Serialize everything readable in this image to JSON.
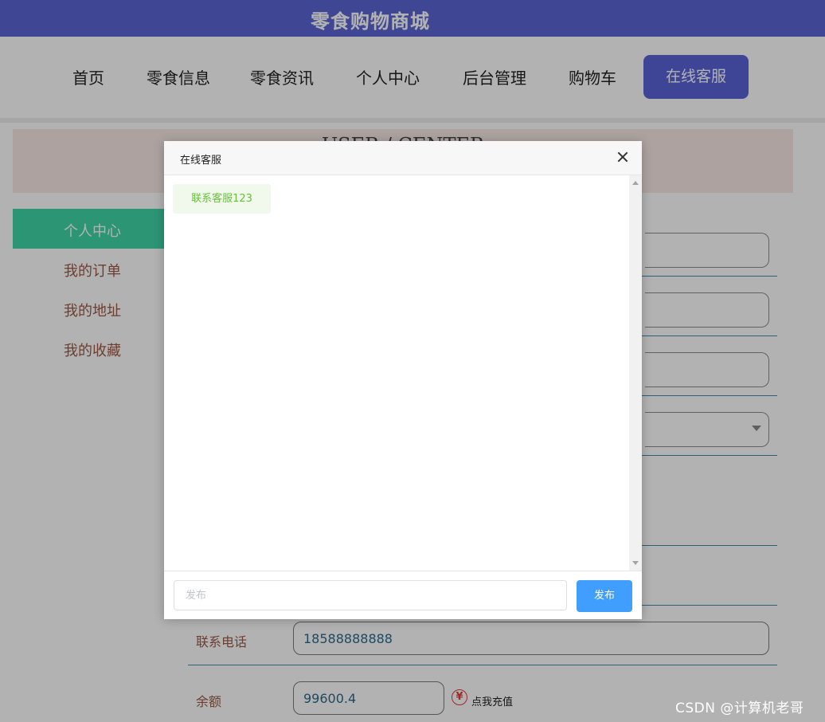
{
  "site": {
    "title": "零食购物商城"
  },
  "nav": {
    "items": [
      "首页",
      "零食信息",
      "零食资讯",
      "个人中心",
      "后台管理",
      "购物车"
    ],
    "customer_service": "在线客服"
  },
  "banner": {
    "text": "USER / CENTER"
  },
  "sidebar": {
    "items": [
      "个人中心",
      "我的订单",
      "我的地址",
      "我的收藏"
    ],
    "active": "个人中心"
  },
  "form": {
    "phone": {
      "label": "联系电话",
      "value": "18588888888"
    },
    "balance": {
      "label": "余额",
      "value": "99600.4"
    },
    "recharge": {
      "icon": "yen-icon",
      "glyph": "¥",
      "label": "点我充值"
    }
  },
  "dialog": {
    "title": "在线客服",
    "close_icon": "close-icon",
    "messages": [
      {
        "text": "联系客服123"
      }
    ],
    "input_placeholder": "发布",
    "send_label": "发布"
  },
  "watermark": "CSDN @计算机老哥",
  "colors": {
    "header": "#5b66d6",
    "sidebar_active": "#3fd6a6",
    "send_button": "#409eff",
    "message_text": "#67c23a"
  }
}
